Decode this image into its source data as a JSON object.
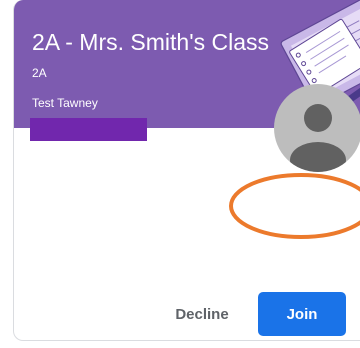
{
  "card": {
    "class_name": "2A - Mrs. Smith's Class",
    "section": "2A",
    "teacher": "Test Tawney"
  },
  "icons": {
    "avatar": "default-person-avatar-icon",
    "header_art": "notebook-clipboard-illustration"
  },
  "actions": {
    "decline_label": "Decline",
    "join_label": "Join"
  },
  "colors": {
    "header_bg": "#7d5bb0",
    "redaction": "#7127ad",
    "join_button": "#1a73e8",
    "decline_text": "#5f6368",
    "annotation_ellipse": "#ec7a2c",
    "avatar_bg": "#bdbdbd",
    "avatar_fg": "#616161"
  }
}
